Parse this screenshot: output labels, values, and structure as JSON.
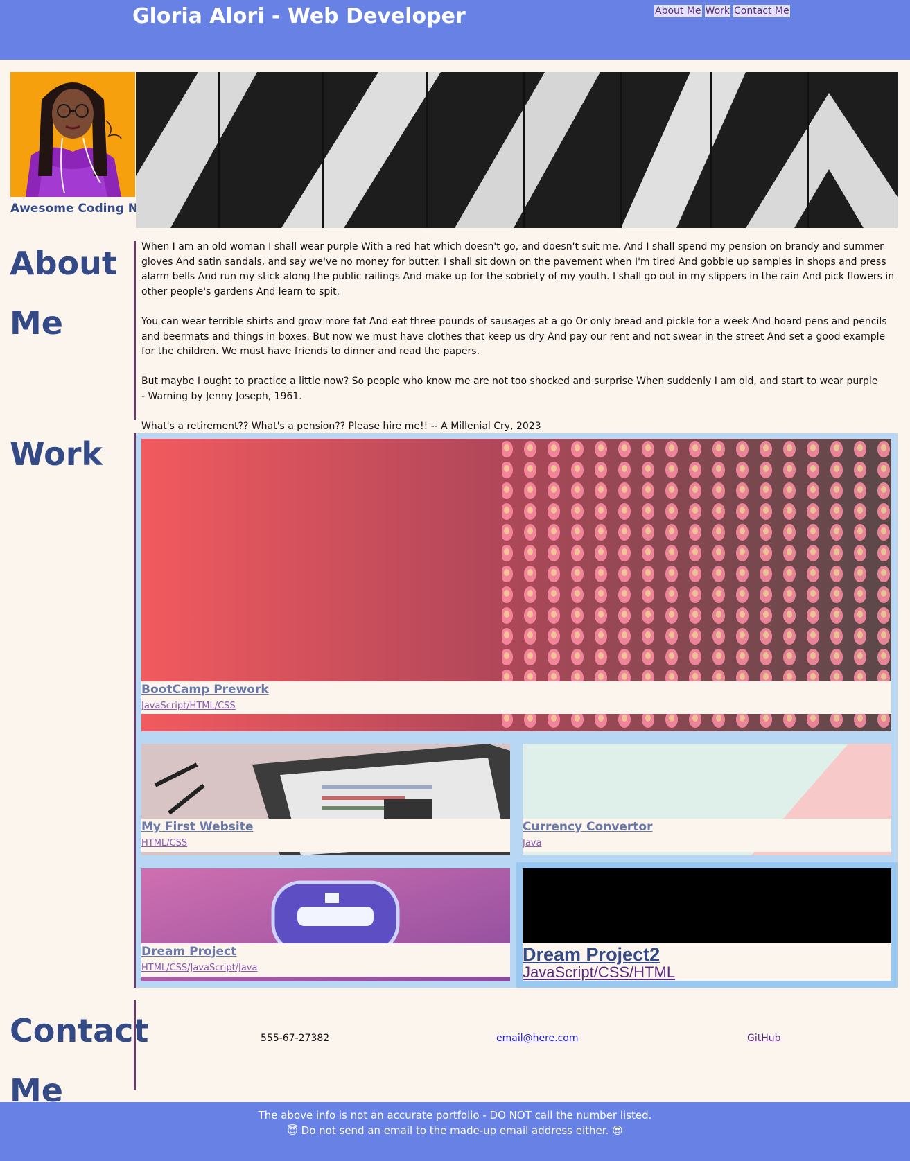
{
  "header": {
    "title": "Gloria Alori - Web Developer",
    "nav": [
      "About Me",
      "Work",
      "Contact Me"
    ]
  },
  "hero": {
    "avatar_caption": "Awesome Coding Noob"
  },
  "about": {
    "heading_line1": "About",
    "heading_line2": "Me",
    "paragraphs": [
      "When I am an old woman I shall wear purple With a red hat which doesn't go, and doesn't suit me. And I shall spend my pension on brandy and summer gloves And satin sandals, and say we've no money for butter. I shall sit down on the pavement when I'm tired And gobble up samples in shops and press alarm bells And run my stick along the public railings And make up for the sobriety of my youth. I shall go out in my slippers in the rain And pick flowers in other people's gardens And learn to spit.",
      "You can wear terrible shirts and grow more fat And eat three pounds of sausages at a go Or only bread and pickle for a week And hoard pens and pencils and beermats and things in boxes. But now we must have clothes that keep us dry And pay our rent and not swear in the street And set a good example for the children. We must have friends to dinner and read the papers.",
      "But maybe I ought to practice a little now? So people who know me are not too shocked and surprise When suddenly I am old, and start to wear purple",
      "- Warning by Jenny Joseph, 1961.",
      "What's a retirement?? What's a pension?? Please hire me!! -- A Millenial Cry, 2023"
    ]
  },
  "work": {
    "heading": "Work",
    "projects": [
      {
        "title": "BootCamp Prework",
        "tech": "JavaScript/HTML/CSS"
      },
      {
        "title": "My First Website",
        "tech": "HTML/CSS"
      },
      {
        "title": "Currency Convertor",
        "tech": "Java"
      },
      {
        "title": "Dream Project",
        "tech": "HTML/CSS/JavaScript/Java"
      },
      {
        "title": "Dream Project2",
        "tech": "JavaScript/CSS/HTML"
      }
    ]
  },
  "contact": {
    "heading_line1": "Contact",
    "heading_line2": "Me",
    "phone": "555-67-27382",
    "email": "email@here.com",
    "github": "GitHub"
  },
  "footer": {
    "line1": "The above info is not an accurate portfolio - DO NOT call the number listed.",
    "line2": "😇 Do not send an email to the made-up email address either. 😎"
  },
  "colors": {
    "header_bg": "#6881e5",
    "page_bg": "#fcf5ee",
    "heading": "#344a86",
    "work_panel_bg": "#b7d7f5"
  }
}
